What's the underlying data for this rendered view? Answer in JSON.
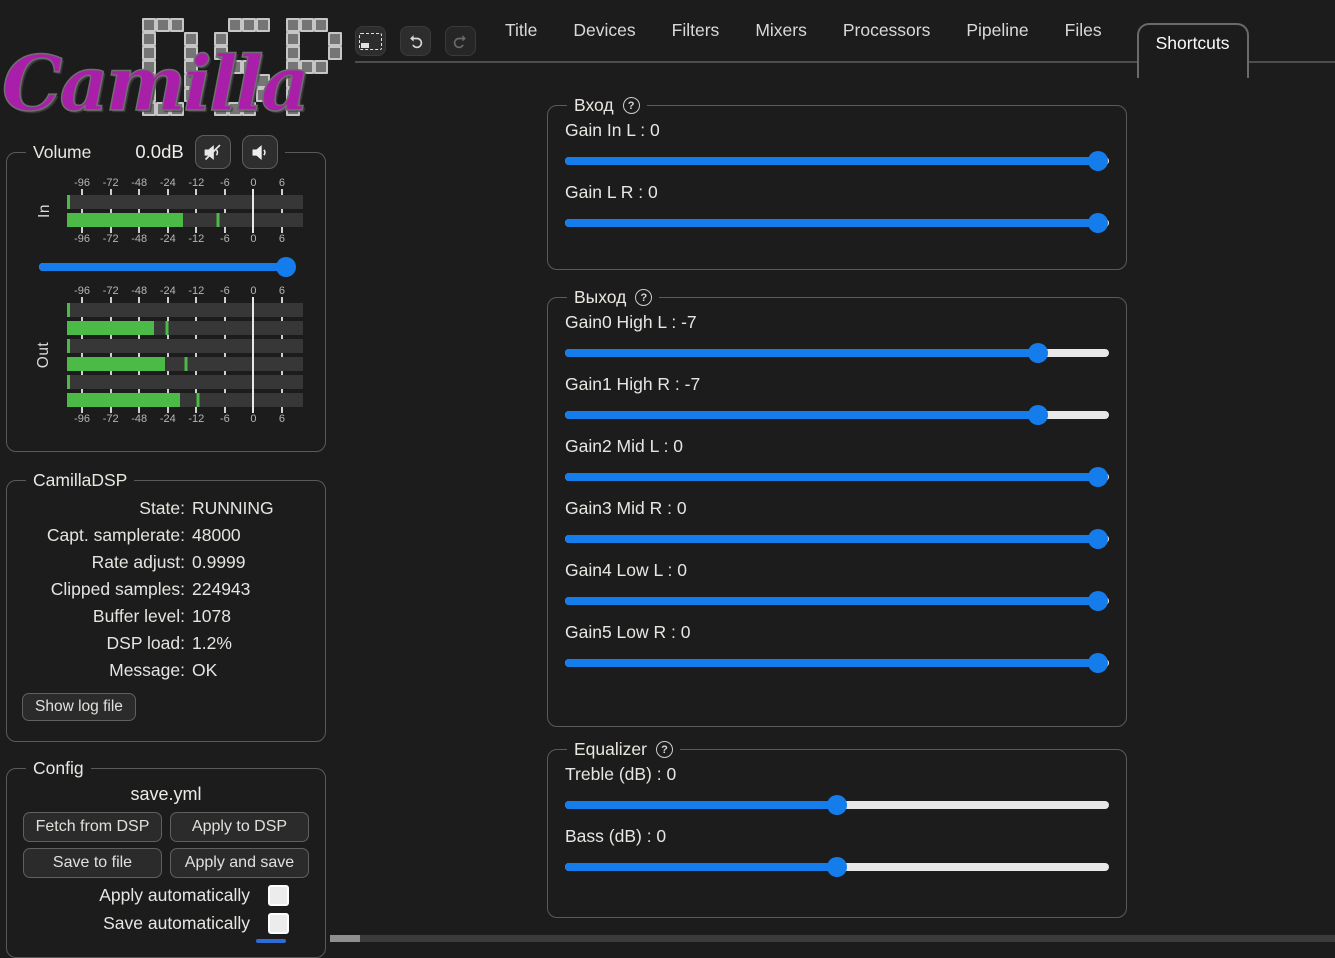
{
  "app": {
    "title": "CamillaDSP"
  },
  "colors": {
    "background": "#1c1c1c",
    "accent_blue": "#147deb",
    "meter_green": "#4cba46",
    "logo_magenta": "#aa1faa",
    "slider_track": "#e8e8e8"
  },
  "logo": {
    "script_text": "Camilla",
    "block_text": "DSP"
  },
  "toolbar": {
    "buttons": [
      {
        "key": "compact-view",
        "icon": "dashed-rectangle-icon",
        "enabled": true
      },
      {
        "key": "undo",
        "icon": "undo-arrow-icon",
        "enabled": true
      },
      {
        "key": "redo",
        "icon": "redo-arrow-icon",
        "enabled": false
      }
    ]
  },
  "tabs": {
    "items": [
      "Title",
      "Devices",
      "Filters",
      "Mixers",
      "Processors",
      "Pipeline",
      "Files",
      "Shortcuts"
    ],
    "active": "Shortcuts"
  },
  "volume": {
    "legend": "Volume",
    "db_label": "0.0dB",
    "mute_icon": "muted-speaker-icon",
    "speaker_icon": "speaker-icon",
    "slider_pct": 97,
    "meter_scale": {
      "labels": [
        "-96",
        "-72",
        "-48",
        "-24",
        "-12",
        "-6",
        "0",
        "6"
      ],
      "positions_pct": [
        6.4,
        18.5,
        30.6,
        42.7,
        54.8,
        66.9,
        79.0,
        91.1
      ],
      "zero_pct": 79.0
    },
    "meters": [
      {
        "label": "In",
        "channels": [
          {
            "fill_pct": 1.2,
            "peak_pct": null
          },
          {
            "fill_pct": 49,
            "peak_pct": 64
          }
        ]
      },
      {
        "label": "Out",
        "channels": [
          {
            "fill_pct": 1.2,
            "peak_pct": null
          },
          {
            "fill_pct": 37,
            "peak_pct": 42.5
          },
          {
            "fill_pct": 1.2,
            "peak_pct": null
          },
          {
            "fill_pct": 41.5,
            "peak_pct": 50.5
          },
          {
            "fill_pct": 1.2,
            "peak_pct": null
          },
          {
            "fill_pct": 48,
            "peak_pct": 55.5
          }
        ]
      }
    ]
  },
  "status": {
    "legend": "CamillaDSP",
    "rows": [
      {
        "label": "State",
        "value": "RUNNING"
      },
      {
        "label": "Capt. samplerate",
        "value": "48000"
      },
      {
        "label": "Rate adjust",
        "value": "0.9999"
      },
      {
        "label": "Clipped samples",
        "value": "224943"
      },
      {
        "label": "Buffer level",
        "value": "1078"
      },
      {
        "label": "DSP load",
        "value": "1.2%"
      },
      {
        "label": "Message",
        "value": "OK"
      }
    ],
    "show_log_button": "Show log file"
  },
  "config": {
    "legend": "Config",
    "filename": "save.yml",
    "buttons": [
      "Fetch from DSP",
      "Apply to DSP",
      "Save to file",
      "Apply and save"
    ],
    "checkboxes": [
      {
        "label": "Apply automatically",
        "checked": false
      },
      {
        "label": "Save automatically",
        "checked": false
      }
    ]
  },
  "shortcut_sections": [
    {
      "key": "input",
      "legend": "Вход",
      "help_icon": "?",
      "sliders": [
        {
          "label": "Gain In L",
          "value": "0",
          "pct": 98
        },
        {
          "label": "Gain L R",
          "value": "0",
          "pct": 98
        }
      ]
    },
    {
      "key": "output",
      "legend": "Выход",
      "help_icon": "?",
      "sliders": [
        {
          "label": "Gain0 High L",
          "value": "-7",
          "pct": 87
        },
        {
          "label": "Gain1 High R",
          "value": "-7",
          "pct": 87
        },
        {
          "label": "Gain2 Mid L",
          "value": "0",
          "pct": 98
        },
        {
          "label": "Gain3 Mid R",
          "value": "0",
          "pct": 98
        },
        {
          "label": "Gain4 Low L",
          "value": "0",
          "pct": 98
        },
        {
          "label": "Gain5 Low R",
          "value": "0",
          "pct": 98
        }
      ]
    },
    {
      "key": "equalizer",
      "legend": "Equalizer",
      "help_icon": "?",
      "sliders": [
        {
          "label": "Treble (dB)",
          "value": "0",
          "pct": 50
        },
        {
          "label": "Bass (dB)",
          "value": "0",
          "pct": 50
        }
      ]
    }
  ]
}
